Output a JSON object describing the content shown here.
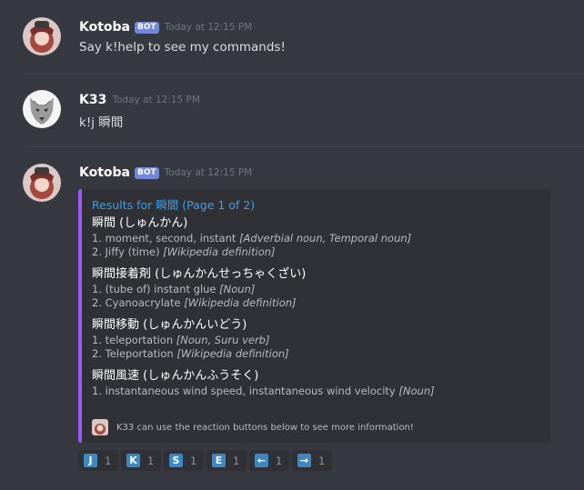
{
  "messages": [
    {
      "username": "Kotoba",
      "bot_tag": "BOT",
      "timestamp": "Today at 12:15 PM",
      "text": "Say k!help to see my commands!"
    },
    {
      "username": "K33",
      "timestamp": "Today at 12:15 PM",
      "text": "k!j 瞬間"
    },
    {
      "username": "Kotoba",
      "bot_tag": "BOT",
      "timestamp": "Today at 12:15 PM",
      "embed": {
        "accent_color": "#9b59f6",
        "title": "Results for 瞬間 (Page 1 of 2)",
        "entries": [
          {
            "heading": "瞬間 (しゅんかん)",
            "defs": [
              {
                "text": "1. moment, second, instant ",
                "tag": "[Adverbial noun, Temporal noun]"
              },
              {
                "text": "2. Jiffy (time) ",
                "tag": "[Wikipedia definition]"
              }
            ]
          },
          {
            "heading": "瞬間接着剤 (しゅんかんせっちゃくざい)",
            "defs": [
              {
                "text": "1. (tube of) instant glue ",
                "tag": "[Noun]"
              },
              {
                "text": "2. Cyanoacrylate ",
                "tag": "[Wikipedia definition]"
              }
            ]
          },
          {
            "heading": "瞬間移動 (しゅんかんいどう)",
            "defs": [
              {
                "text": "1. teleportation ",
                "tag": "[Noun, Suru verb]"
              },
              {
                "text": "2. Teleportation ",
                "tag": "[Wikipedia definition]"
              }
            ]
          },
          {
            "heading": "瞬間風速 (しゅんかんふうそく)",
            "defs": [
              {
                "text": "1. instantaneous wind speed, instantaneous wind velocity ",
                "tag": "[Noun]"
              }
            ]
          }
        ],
        "footer": "K33 can use the reaction buttons below to see more information!"
      },
      "reactions": [
        {
          "emoji": "J",
          "count": "1",
          "icon": "regional-indicator-j-icon"
        },
        {
          "emoji": "K",
          "count": "1",
          "icon": "regional-indicator-k-icon"
        },
        {
          "emoji": "S",
          "count": "1",
          "icon": "regional-indicator-s-icon"
        },
        {
          "emoji": "E",
          "count": "1",
          "icon": "regional-indicator-e-icon"
        },
        {
          "emoji": "←",
          "count": "1",
          "icon": "arrow-left-icon"
        },
        {
          "emoji": "→",
          "count": "1",
          "icon": "arrow-right-icon"
        }
      ]
    }
  ],
  "colors": {
    "background": "#36393f",
    "embed_bg": "#2f3136",
    "embed_accent": "#9b59f6",
    "link": "#3aa0e8",
    "bot_tag": "#7289da",
    "reaction_emoji": "#3b88c3"
  }
}
